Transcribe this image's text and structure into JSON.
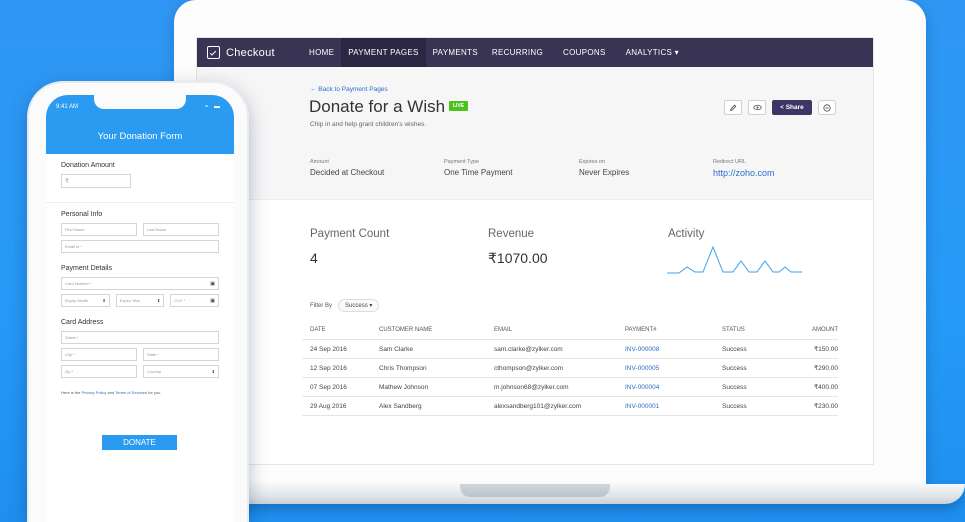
{
  "app": {
    "brand": "Checkout",
    "nav": [
      "HOME",
      "PAYMENT PAGES",
      "PAYMENTS",
      "RECURRING",
      "COUPONS",
      "ANALYTICS ▾"
    ]
  },
  "page": {
    "back_link": "← Back to Payment Pages",
    "title": "Donate for a Wish",
    "badge": "LIVE",
    "subtitle": "Chip in and help grant children's wishes.",
    "actions": {
      "edit_icon": "pencil-icon",
      "preview_icon": "eye-icon",
      "share_label": "Share",
      "more_icon": "more-icon"
    },
    "meta": [
      {
        "label": "Amount",
        "value": "Decided at Checkout"
      },
      {
        "label": "Payment Type",
        "value": "One Time Payment"
      },
      {
        "label": "Expires on",
        "value": "Never Expires"
      },
      {
        "label": "Redirect URL",
        "value": "http://zoho.com"
      }
    ]
  },
  "stats": {
    "payment_count_label": "Payment Count",
    "payment_count_value": "4",
    "revenue_label": "Revenue",
    "revenue_value": "₹1070.00",
    "activity_label": "Activity"
  },
  "filter": {
    "label": "Filter By",
    "value": "Success ▾"
  },
  "table": {
    "headers": [
      "DATE",
      "CUSTOMER NAME",
      "EMAIL",
      "PAYMENT#",
      "STATUS",
      "AMOUNT"
    ],
    "rows": [
      [
        "24 Sep 2016",
        "Sam Clarke",
        "sam.clarke@zylker.com",
        "INV-000008",
        "Success",
        "₹150.00"
      ],
      [
        "12 Sep 2016",
        "Chris Thompson",
        "cthompson@zylker.com",
        "INV-000005",
        "Success",
        "₹290.00"
      ],
      [
        "07 Sep 2016",
        "Mathew Johnson",
        "m.johnson68@zylker.com",
        "INV-000004",
        "Success",
        "₹400.00"
      ],
      [
        "29 Aug 2016",
        "Alex Sandberg",
        "alexsandberg101@zylker.com",
        "INV-000001",
        "Success",
        "₹230.00"
      ]
    ]
  },
  "phone": {
    "time": "9:41 AM",
    "title": "Your Donation Form",
    "donation_amount_label": "Donation Amount",
    "currency": "₹",
    "personal_info": "Personal Info",
    "first_name": "First Name",
    "last_name": "Last Name",
    "email": "Email id *",
    "payment_details": "Payment Details",
    "card_number": "Card Number *",
    "expiry_month": "Expiry Month",
    "expiry_year": "Expiry Year",
    "cvv": "CVV *",
    "card_address": "Card Address",
    "street": "Street *",
    "city": "City *",
    "state": "State *",
    "zip": "Zip *",
    "country": "Country",
    "terms_prefix": "Here is the",
    "privacy": "Privacy Policy",
    "and": "and",
    "tos": "Terms of Services",
    "terms_suffix": "for you",
    "donate": "DONATE"
  },
  "colors": {
    "nav_bg": "#393453",
    "accent_blue": "#2a9bf1",
    "share_btn": "#3d3564",
    "live_green": "#4cc21f"
  }
}
